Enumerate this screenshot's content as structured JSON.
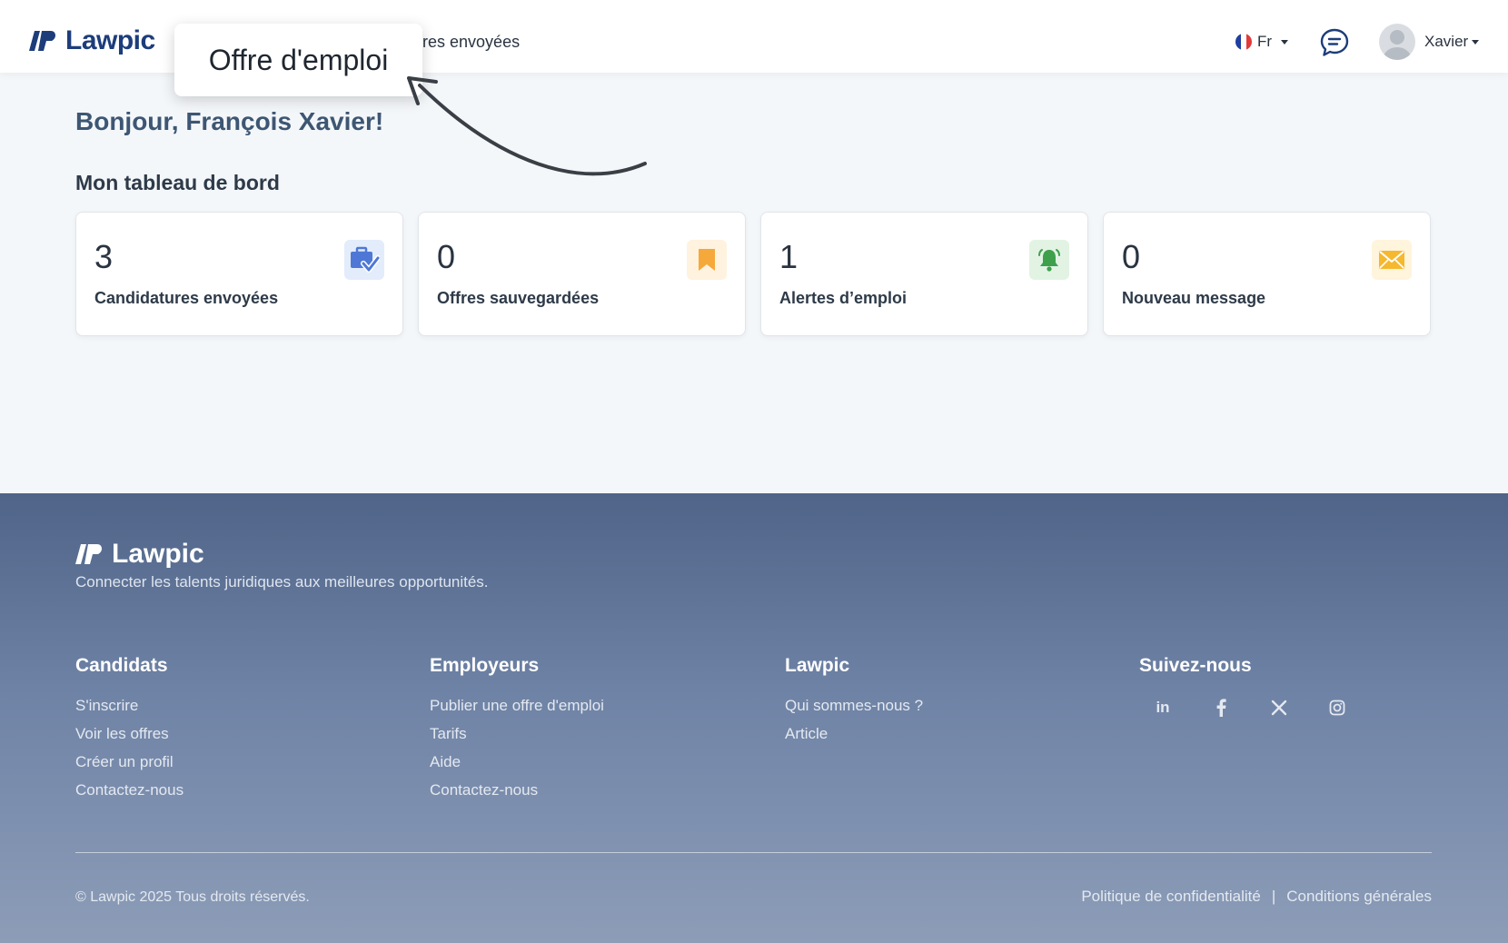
{
  "header": {
    "brand": "Lawpic",
    "nav_visible_fragment": "atures envoyées",
    "language": "Fr",
    "user_name": "Xavier"
  },
  "callout": {
    "text": "Offre d'emploi"
  },
  "main": {
    "greeting": "Bonjour, François Xavier!",
    "section_title": "Mon tableau de bord",
    "cards": [
      {
        "value": "3",
        "label": "Candidatures envoyées",
        "icon": "briefcase-check-icon",
        "icon_bg": "#e3ecfb",
        "icon_color": "#4f78d6"
      },
      {
        "value": "0",
        "label": "Offres sauvegardées",
        "icon": "bookmark-icon",
        "icon_bg": "#fff2df",
        "icon_color": "#f5a93b"
      },
      {
        "value": "1",
        "label": "Alertes d’emploi",
        "icon": "bell-icon",
        "icon_bg": "#e2f3e4",
        "icon_color": "#3fa04c"
      },
      {
        "value": "0",
        "label": "Nouveau message",
        "icon": "envelope-icon",
        "icon_bg": "#fff4dc",
        "icon_color": "#f5b82e"
      }
    ]
  },
  "footer": {
    "brand": "Lawpic",
    "tagline": "Connecter les talents juridiques aux meilleures opportunités.",
    "columns": [
      {
        "title": "Candidats",
        "links": [
          "S'inscrire",
          "Voir les offres",
          "Créer un profil",
          "Contactez-nous"
        ]
      },
      {
        "title": "Employeurs",
        "links": [
          "Publier une offre d'emploi",
          "Tarifs",
          "Aide",
          "Contactez-nous"
        ]
      },
      {
        "title": "Lawpic",
        "links": [
          "Qui sommes-nous ?",
          "Article"
        ]
      },
      {
        "title": "Suivez-nous",
        "links": []
      }
    ],
    "social": [
      "linkedin-icon",
      "facebook-icon",
      "x-icon",
      "instagram-icon"
    ],
    "copyright": "© Lawpic 2025 Tous droits réservés.",
    "legal": {
      "privacy": "Politique de confidentialité",
      "separator": "|",
      "terms": "Conditions générales"
    }
  }
}
